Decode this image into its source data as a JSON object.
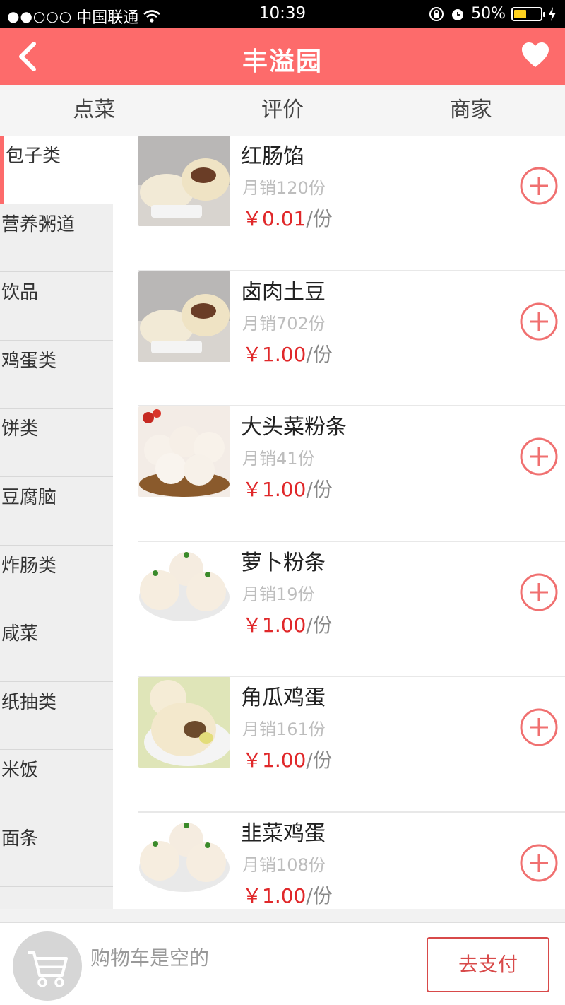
{
  "status": {
    "signal": "●●○○○",
    "carrier": "中国联通",
    "time": "10:39",
    "battery": "50%",
    "battery_level": 0.5
  },
  "header": {
    "title": "丰溢园"
  },
  "tabs": [
    {
      "label": "点菜"
    },
    {
      "label": "评价"
    },
    {
      "label": "商家"
    }
  ],
  "sidebar": {
    "items": [
      {
        "label": "包子类",
        "active": true
      },
      {
        "label": "营养粥道"
      },
      {
        "label": "饮品"
      },
      {
        "label": "鸡蛋类"
      },
      {
        "label": "饼类"
      },
      {
        "label": "豆腐脑"
      },
      {
        "label": "炸肠类"
      },
      {
        "label": "咸菜"
      },
      {
        "label": "纸抽类"
      },
      {
        "label": "米饭"
      },
      {
        "label": "面条"
      }
    ]
  },
  "products": [
    {
      "name": "红肠馅",
      "sales": "月销120份",
      "price": "￥0.01",
      "unit": "/份"
    },
    {
      "name": "卤肉土豆",
      "sales": "月销702份",
      "price": "￥1.00",
      "unit": "/份"
    },
    {
      "name": "大头菜粉条",
      "sales": "月销41份",
      "price": "￥1.00",
      "unit": "/份"
    },
    {
      "name": "萝卜粉条",
      "sales": "月销19份",
      "price": "￥1.00",
      "unit": "/份"
    },
    {
      "name": "角瓜鸡蛋",
      "sales": "月销161份",
      "price": "￥1.00",
      "unit": "/份"
    },
    {
      "name": "韭菜鸡蛋",
      "sales": "月销108份",
      "price": "￥1.00",
      "unit": "/份"
    }
  ],
  "cart": {
    "empty_text": "购物车是空的",
    "pay_label": "去支付"
  },
  "colors": {
    "brand": "#fd6b6b",
    "price": "#e0282a",
    "pay_border": "#d84a4a"
  }
}
